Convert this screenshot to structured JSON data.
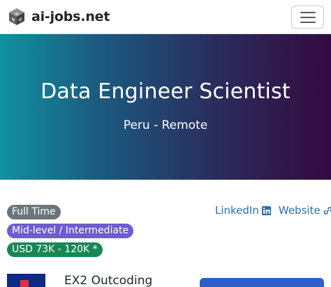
{
  "navbar": {
    "brand_name": "ai-jobs.net",
    "menu_icon": "hamburger-menu-icon",
    "logo_icon": "cube-logo-icon"
  },
  "job": {
    "title": "Data Engineer Scientist",
    "location": "Peru - Remote"
  },
  "badges": {
    "employment_type": "Full Time",
    "experience_level": "Mid-level / Intermediate",
    "salary": "USD 73K - 120K *"
  },
  "links": {
    "linkedin_label": "LinkedIn",
    "linkedin_icon": "linkedin-icon",
    "website_label": "Website",
    "website_icon": "link-icon"
  },
  "company": {
    "name": "EX2 Outcoding"
  },
  "colors": {
    "hero_gradient_start": "#11919f",
    "hero_gradient_end": "#330a40",
    "badge_full_time": "#6c757d",
    "badge_level": "#6f5bd2",
    "badge_salary": "#198754",
    "link": "#2f6fb0",
    "apply_button": "#2b5fc9"
  }
}
